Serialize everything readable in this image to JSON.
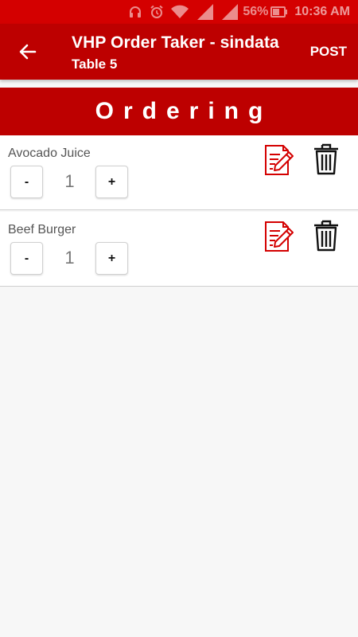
{
  "status_bar": {
    "battery": "56%",
    "time": "10:36 AM",
    "icons": [
      "headphones-icon",
      "alarm-icon",
      "wifi-icon",
      "signal-icon",
      "signal-icon",
      "battery-icon"
    ]
  },
  "app_bar": {
    "title": "VHP Order Taker - sindata",
    "subtitle": "Table 5",
    "post_label": "POST",
    "back_icon": "arrow-left-icon"
  },
  "section": {
    "title": "Ordering"
  },
  "orders": [
    {
      "name": "Avocado Juice",
      "quantity": "1",
      "minus": "-",
      "plus": "+"
    },
    {
      "name": "Beef Burger",
      "quantity": "1",
      "minus": "-",
      "plus": "+"
    }
  ],
  "colors": {
    "status_bar": "#d40000",
    "primary": "#bd0000",
    "edit_icon": "#d40000",
    "trash_icon": "#111111",
    "background": "#f7f7f7"
  }
}
